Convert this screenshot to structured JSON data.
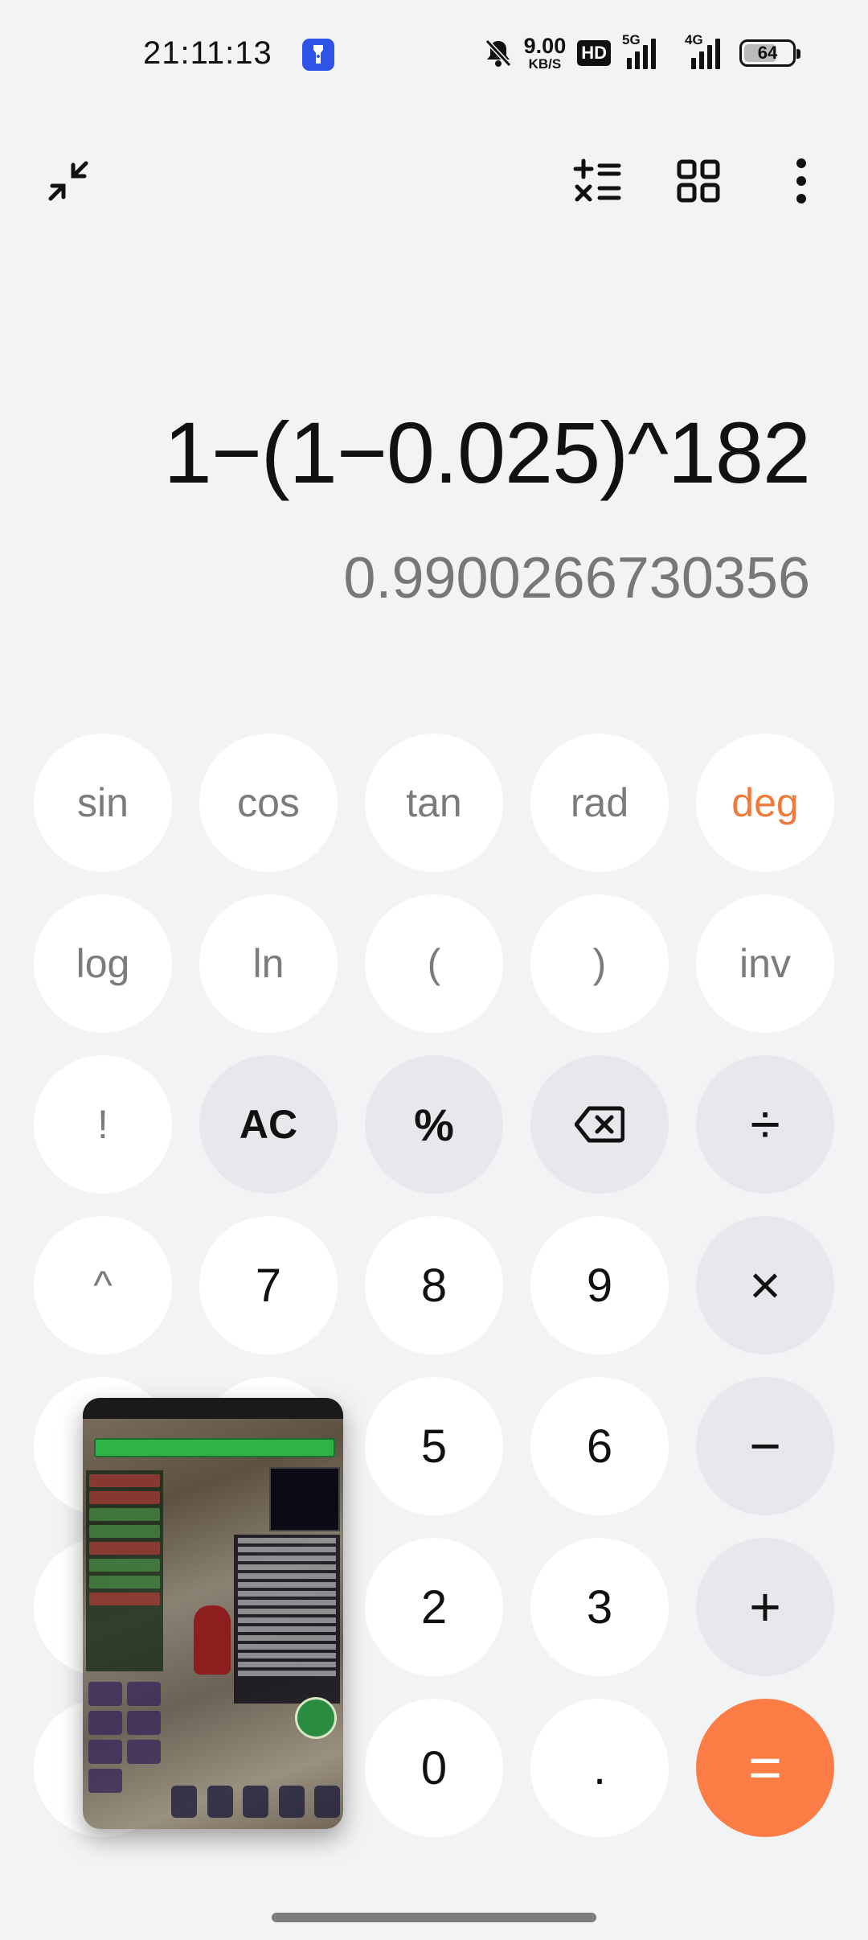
{
  "status_bar": {
    "time": "21:11:13",
    "net_speed_value": "9.00",
    "net_speed_unit": "KB/S",
    "hd_label": "HD",
    "signal1_label": "5G",
    "signal2_label": "4G",
    "battery_level": "64"
  },
  "toolbar": {
    "collapse_icon": "collapse-arrows-icon",
    "history_icon": "plus-minus-times-equal-icon",
    "apps_icon": "grid-four-squares-icon",
    "more_icon": "vertical-dots-icon"
  },
  "display": {
    "expression": "1−(1−0.025)^182",
    "result": "0.9900266730356"
  },
  "keypad": {
    "sin": "sin",
    "cos": "cos",
    "tan": "tan",
    "rad": "rad",
    "deg": "deg",
    "log": "log",
    "ln": "ln",
    "lparen": "(",
    "rparen": ")",
    "inv": "inv",
    "factorial": "!",
    "ac": "AC",
    "percent": "%",
    "divide": "÷",
    "power": "^",
    "seven": "7",
    "eight": "8",
    "nine": "9",
    "multiply": "×",
    "five": "5",
    "six": "6",
    "minus": "−",
    "two": "2",
    "three": "3",
    "plus": "+",
    "zero": "0",
    "dot": ".",
    "equals": "="
  },
  "colors": {
    "accent": "#fb7d45",
    "deg_text": "#f07a3c",
    "background": "#f2f3f5"
  }
}
